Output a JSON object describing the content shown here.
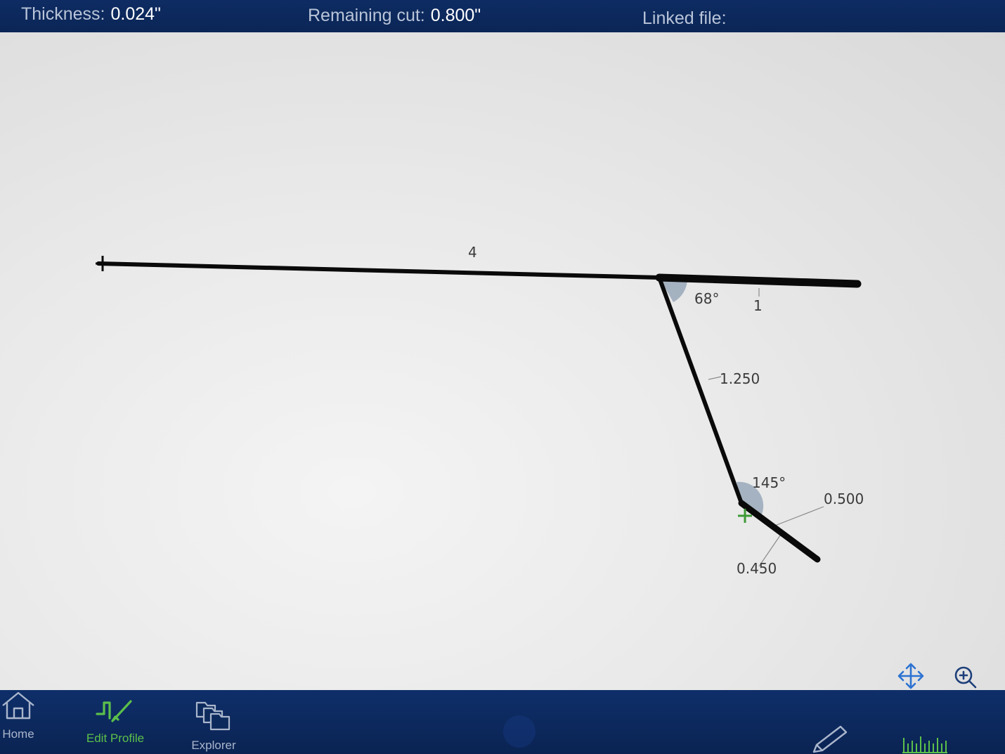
{
  "status_bar": {
    "thickness_label": "Thickness:",
    "thickness_value": "0.024\"",
    "remaining_label": "Remaining cut:",
    "remaining_value": "0.800\"",
    "linked_label": "Linked file:",
    "linked_value": ""
  },
  "profile": {
    "segment_labels": {
      "top_left": "4",
      "top_right": "1",
      "middle": "1.250",
      "short_upper": "0.500",
      "short_lower": "0.450"
    },
    "angle_labels": {
      "first": "68°",
      "second": "145°"
    }
  },
  "canvas_tools": {
    "pan_icon": "pan-arrows-icon",
    "zoom_icon": "zoom-in-icon"
  },
  "bottom_nav": {
    "home_label": "Home",
    "edit_profile_label": "Edit Profile",
    "explorer_label": "Explorer"
  },
  "colors": {
    "bar_background": "#0d2a5c",
    "accent_green": "#5cc04a",
    "angle_marker": "#8e9fb3",
    "icon_blue": "#2c73d2"
  }
}
